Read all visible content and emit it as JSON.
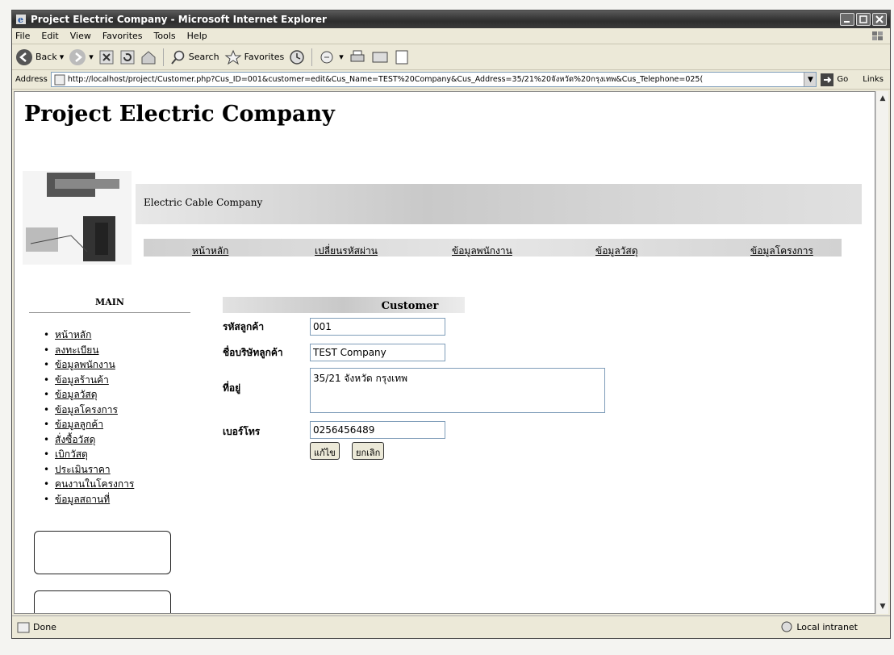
{
  "window": {
    "title": "Project Electric Company - Microsoft Internet Explorer"
  },
  "menu": [
    "File",
    "Edit",
    "View",
    "Favorites",
    "Tools",
    "Help"
  ],
  "toolbar": {
    "back_label": "Back",
    "search_label": "Search",
    "favorites_label": "Favorites"
  },
  "address": {
    "label": "Address",
    "url": "http://localhost/project/Customer.php?Cus_ID=001&customer=edit&Cus_Name=TEST%20Company&Cus_Address=35/21%20จังหวัด%20กรุงเทพ&Cus_Telephone=025(",
    "go_label": "Go",
    "links_label": "Links"
  },
  "page": {
    "site_title": "Project Electric Company",
    "banner_subtitle": "Electric Cable Company",
    "nav": [
      "หน้าหลัก",
      "เปลี่ยนรหัสผ่าน",
      "ข้อมูลพนักงาน",
      "ข้อมูลวัสดุ",
      "ข้อมูลโครงการ"
    ],
    "sidebar_heading": "MAIN",
    "sidebar_items": [
      "หน้าหลัก",
      "ลงทะเบียน",
      "ข้อมูลพนักงาน",
      "ข้อมูลร้านค้า",
      "ข้อมูลวัสดุ",
      "ข้อมูลโครงการ",
      "ข้อมูลลูกค้า",
      "สั่งซื้อวัสดุ",
      "เบิกวัสดุ",
      "ประเมินราคา",
      "คนงานในโครงการ",
      "ข้อมูลสถานที่"
    ],
    "form": {
      "heading": "Customer",
      "id_label": "รหัสลูกค้า",
      "id_value": "001",
      "name_label": "ชื่อบริษัทลูกค้า",
      "name_value": "TEST Company",
      "address_label": "ที่อยู่",
      "address_value": "35/21 จังหวัด กรุงเทพ",
      "phone_label": "เบอร์โทร",
      "phone_value": "0256456489",
      "edit_button": "แก้ไข",
      "cancel_button": "ยกเลิก"
    }
  },
  "status": {
    "left": "Done",
    "zone": "Local intranet"
  }
}
